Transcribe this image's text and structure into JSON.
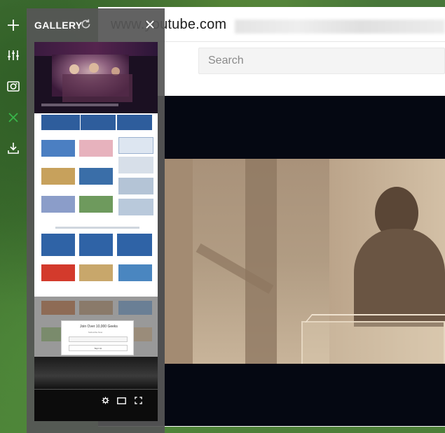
{
  "browser": {
    "url": "www.youtube.com",
    "search_placeholder": "Search"
  },
  "gallery": {
    "title": "GALLERY"
  },
  "toolstrip": {
    "tools": [
      "plus-icon",
      "equalizer-icon",
      "camera-icon",
      "close-x-icon",
      "download-icon"
    ]
  },
  "thumbnails": {
    "popup_title": "Join Over 10,000 Geeks",
    "popup_subtitle": "Subscribe Now",
    "popup_button": "Sign Up"
  },
  "colors": {
    "accent_green": "#39b54a",
    "gallery_bg": "#565656",
    "tile_blue": "#2e5d9c"
  }
}
